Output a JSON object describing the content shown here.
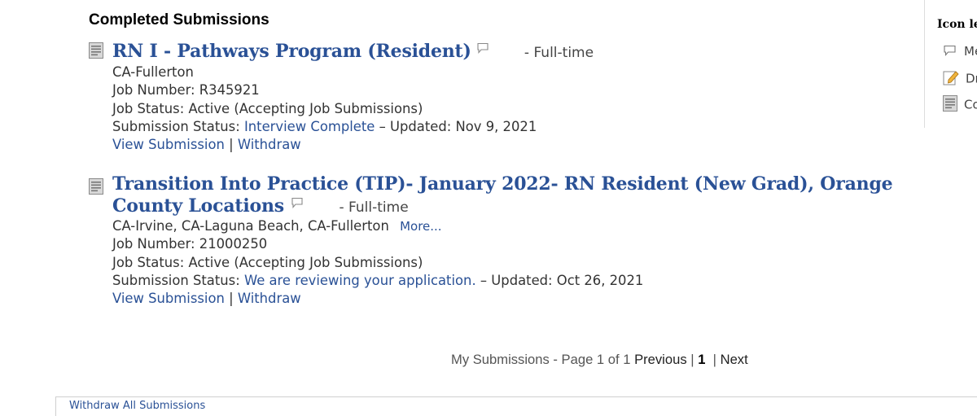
{
  "section": {
    "heading": "Completed Submissions"
  },
  "jobs": [
    {
      "title": "RN I - Pathways Program (Resident)",
      "type": "- Full-time",
      "location": "CA-Fullerton",
      "job_number": "Job Number: R345921",
      "job_status": "Job Status: Active (Accepting Job Submissions)",
      "submission_label": "Submission Status:",
      "submission_status": "Interview Complete",
      "updated": "– Updated: Nov 9, 2021",
      "view": "View Submission",
      "separator": "|",
      "withdraw": "Withdraw"
    },
    {
      "title_line1": "Transition Into Practice (TIP)- January 2022- RN Resident (New Grad), Orange",
      "title_line2": "County Locations",
      "type": "- Full-time",
      "location": "CA-Irvine, CA-Laguna Beach, CA-Fullerton",
      "more": "More...",
      "job_number": "Job Number: 21000250",
      "job_status": "Job Status: Active (Accepting Job Submissions)",
      "submission_label": "Submission Status:",
      "submission_status": "We are reviewing your application.",
      "updated": "– Updated: Oct 26, 2021",
      "view": "View Submission",
      "separator": "|",
      "withdraw": "Withdraw"
    }
  ],
  "pager": {
    "text": "My Submissions - Page 1 of 1",
    "previous": "Previous",
    "sep1": "|",
    "current": "1",
    "sep2": "|",
    "next": "Next"
  },
  "legend": {
    "title": "Icon le",
    "items": [
      {
        "label": "Me",
        "icon": "comment-icon"
      },
      {
        "label": "Dr",
        "icon": "draft-pencil-icon"
      },
      {
        "label": "Co",
        "icon": "completed-document-icon"
      }
    ]
  },
  "bottom": {
    "link": "Withdraw All Submissions"
  },
  "colors": {
    "link": "#2a5196",
    "text": "#333333"
  }
}
